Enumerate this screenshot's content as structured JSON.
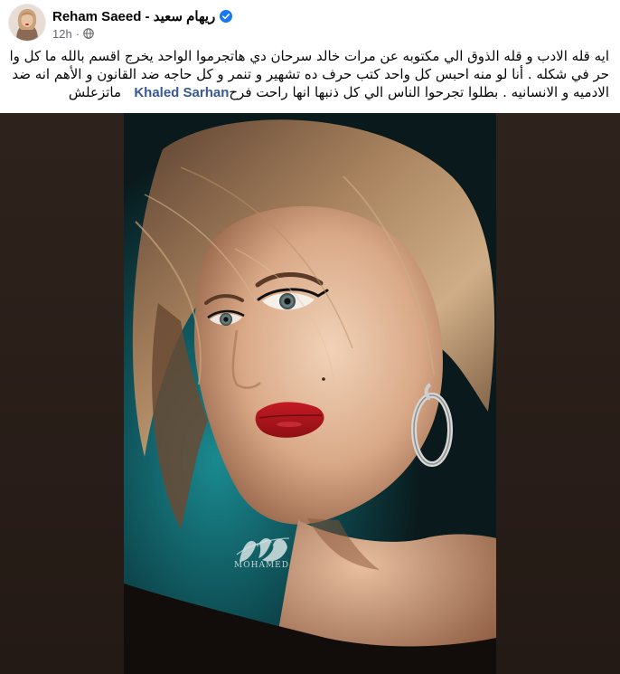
{
  "post": {
    "author": {
      "name": "Reham Saeed - ريهام سعيد",
      "verified": true
    },
    "meta": {
      "time": "12h",
      "separator": "·",
      "audience_icon": "globe-icon"
    },
    "text_lines": [
      "ايه قله الادب و قله الذوق الي مكتوبه عن  مرات خالد سرحان دي هاتجرموا  الواحد يخرج اقسم بالله ما كل واحد",
      "حر في شكله . أنا لو منه احبس كل واحد كتب حرف  ده تشهير و تنمر و كل حاجه ضد القانون و الأهم انه ضد",
      "الادميه و الانسانيه . بطلوا تجرحوا الناس الي كل ذنبها انها راحت فرح"
    ],
    "mention": "Khaled Sarhan",
    "text_tail": "ماتزعلش",
    "photo": {
      "watermark_name": "MOHAMED",
      "watermark_monogram": "M"
    }
  },
  "colors": {
    "link": "#385898",
    "verified": "#1877f2",
    "secondary_text": "#65676b",
    "lip_red": "#b5121b",
    "teal": "#1a7f86"
  }
}
